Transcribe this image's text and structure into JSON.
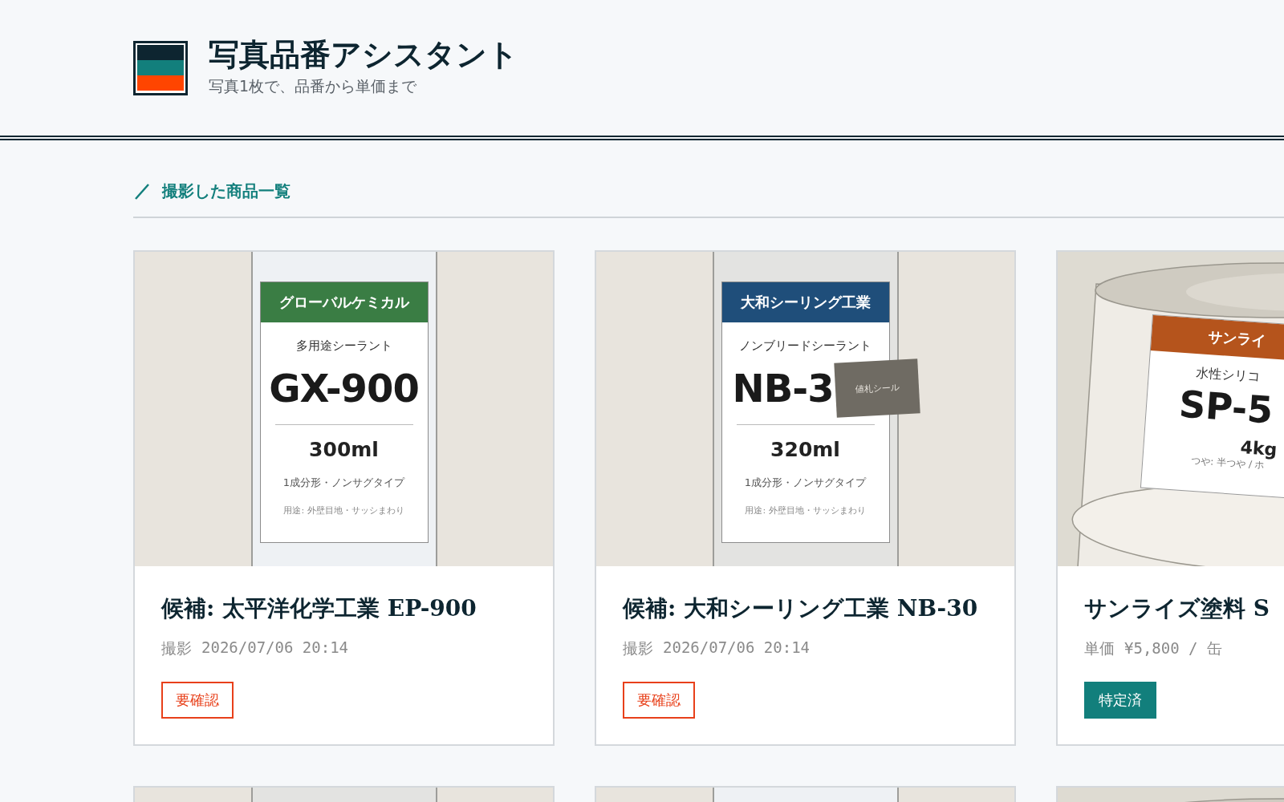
{
  "app": {
    "title": "写真品番アシスタント",
    "subtitle": "写真1枚で、品番から単価まで"
  },
  "section": {
    "title": "撮影した商品一覧"
  },
  "products": [
    {
      "image": {
        "kind": "tube",
        "color": "#eef1f4",
        "label": {
          "color": "#3a7d44",
          "brand": "グローバルケミカル",
          "product_type": "多用途シーラント",
          "model": "GX-900",
          "volume": "300ml",
          "spec": "1成分形・ノンサグタイプ",
          "usage": "用途: 外壁目地・サッシまわり"
        }
      },
      "title": "候補: 太平洋化学工業 EP-900",
      "meta_label": "撮影",
      "meta_value": "2026/07/06 20:14",
      "status": {
        "kind": "review",
        "label": "要確認"
      }
    },
    {
      "image": {
        "kind": "tube",
        "color": "#e3e3e1",
        "label": {
          "color": "#1f4e7a",
          "brand": "大和シーリング工業",
          "product_type": "ノンブリードシーラント",
          "model": "NB-3",
          "sticker": "値札シール",
          "volume": "320ml",
          "spec": "1成分形・ノンサグタイプ",
          "usage": "用途: 外壁目地・サッシまわり"
        }
      },
      "title": "候補: 大和シーリング工業 NB-30",
      "meta_label": "撮影",
      "meta_value": "2026/07/06 20:14",
      "status": {
        "kind": "review",
        "label": "要確認"
      }
    },
    {
      "image": {
        "kind": "can",
        "label": {
          "color": "#b5541c",
          "brand": "サンライ",
          "product_type": "水性シリコ",
          "model": "SP-5",
          "volume": "4kg",
          "spec": "つや: 半つや / ホ"
        }
      },
      "title": "サンライズ塗料 S",
      "meta_label": "単価",
      "meta_value": "¥5,800 / 缶",
      "status": {
        "kind": "identified",
        "label": "特定済"
      }
    }
  ],
  "more_products": [
    {
      "kind": "tube",
      "color": "#e3e3e1"
    },
    {
      "kind": "tube",
      "color": "#eef1f4"
    },
    {
      "kind": "can"
    }
  ]
}
